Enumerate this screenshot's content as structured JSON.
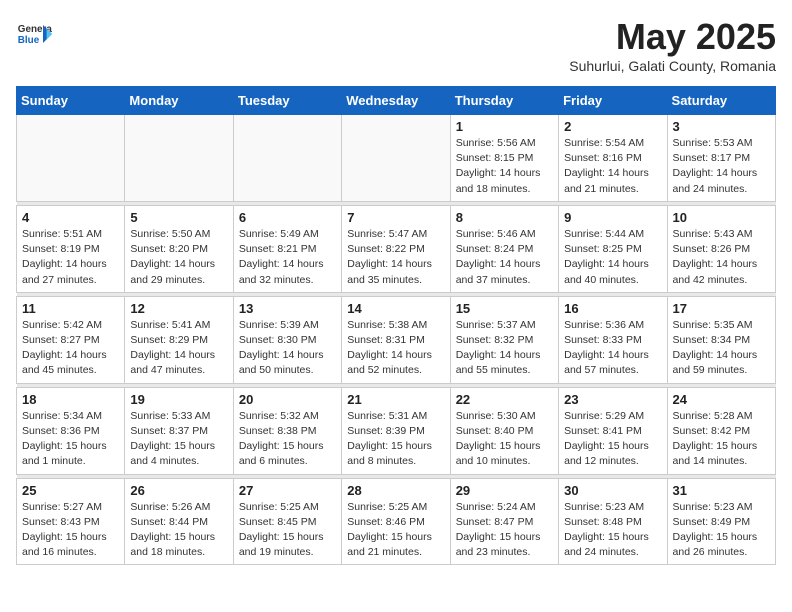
{
  "header": {
    "logo_general": "General",
    "logo_blue": "Blue",
    "month_title": "May 2025",
    "subtitle": "Suhurlui, Galati County, Romania"
  },
  "weekdays": [
    "Sunday",
    "Monday",
    "Tuesday",
    "Wednesday",
    "Thursday",
    "Friday",
    "Saturday"
  ],
  "weeks": [
    [
      {
        "day": "",
        "info": ""
      },
      {
        "day": "",
        "info": ""
      },
      {
        "day": "",
        "info": ""
      },
      {
        "day": "",
        "info": ""
      },
      {
        "day": "1",
        "info": "Sunrise: 5:56 AM\nSunset: 8:15 PM\nDaylight: 14 hours\nand 18 minutes."
      },
      {
        "day": "2",
        "info": "Sunrise: 5:54 AM\nSunset: 8:16 PM\nDaylight: 14 hours\nand 21 minutes."
      },
      {
        "day": "3",
        "info": "Sunrise: 5:53 AM\nSunset: 8:17 PM\nDaylight: 14 hours\nand 24 minutes."
      }
    ],
    [
      {
        "day": "4",
        "info": "Sunrise: 5:51 AM\nSunset: 8:19 PM\nDaylight: 14 hours\nand 27 minutes."
      },
      {
        "day": "5",
        "info": "Sunrise: 5:50 AM\nSunset: 8:20 PM\nDaylight: 14 hours\nand 29 minutes."
      },
      {
        "day": "6",
        "info": "Sunrise: 5:49 AM\nSunset: 8:21 PM\nDaylight: 14 hours\nand 32 minutes."
      },
      {
        "day": "7",
        "info": "Sunrise: 5:47 AM\nSunset: 8:22 PM\nDaylight: 14 hours\nand 35 minutes."
      },
      {
        "day": "8",
        "info": "Sunrise: 5:46 AM\nSunset: 8:24 PM\nDaylight: 14 hours\nand 37 minutes."
      },
      {
        "day": "9",
        "info": "Sunrise: 5:44 AM\nSunset: 8:25 PM\nDaylight: 14 hours\nand 40 minutes."
      },
      {
        "day": "10",
        "info": "Sunrise: 5:43 AM\nSunset: 8:26 PM\nDaylight: 14 hours\nand 42 minutes."
      }
    ],
    [
      {
        "day": "11",
        "info": "Sunrise: 5:42 AM\nSunset: 8:27 PM\nDaylight: 14 hours\nand 45 minutes."
      },
      {
        "day": "12",
        "info": "Sunrise: 5:41 AM\nSunset: 8:29 PM\nDaylight: 14 hours\nand 47 minutes."
      },
      {
        "day": "13",
        "info": "Sunrise: 5:39 AM\nSunset: 8:30 PM\nDaylight: 14 hours\nand 50 minutes."
      },
      {
        "day": "14",
        "info": "Sunrise: 5:38 AM\nSunset: 8:31 PM\nDaylight: 14 hours\nand 52 minutes."
      },
      {
        "day": "15",
        "info": "Sunrise: 5:37 AM\nSunset: 8:32 PM\nDaylight: 14 hours\nand 55 minutes."
      },
      {
        "day": "16",
        "info": "Sunrise: 5:36 AM\nSunset: 8:33 PM\nDaylight: 14 hours\nand 57 minutes."
      },
      {
        "day": "17",
        "info": "Sunrise: 5:35 AM\nSunset: 8:34 PM\nDaylight: 14 hours\nand 59 minutes."
      }
    ],
    [
      {
        "day": "18",
        "info": "Sunrise: 5:34 AM\nSunset: 8:36 PM\nDaylight: 15 hours\nand 1 minute."
      },
      {
        "day": "19",
        "info": "Sunrise: 5:33 AM\nSunset: 8:37 PM\nDaylight: 15 hours\nand 4 minutes."
      },
      {
        "day": "20",
        "info": "Sunrise: 5:32 AM\nSunset: 8:38 PM\nDaylight: 15 hours\nand 6 minutes."
      },
      {
        "day": "21",
        "info": "Sunrise: 5:31 AM\nSunset: 8:39 PM\nDaylight: 15 hours\nand 8 minutes."
      },
      {
        "day": "22",
        "info": "Sunrise: 5:30 AM\nSunset: 8:40 PM\nDaylight: 15 hours\nand 10 minutes."
      },
      {
        "day": "23",
        "info": "Sunrise: 5:29 AM\nSunset: 8:41 PM\nDaylight: 15 hours\nand 12 minutes."
      },
      {
        "day": "24",
        "info": "Sunrise: 5:28 AM\nSunset: 8:42 PM\nDaylight: 15 hours\nand 14 minutes."
      }
    ],
    [
      {
        "day": "25",
        "info": "Sunrise: 5:27 AM\nSunset: 8:43 PM\nDaylight: 15 hours\nand 16 minutes."
      },
      {
        "day": "26",
        "info": "Sunrise: 5:26 AM\nSunset: 8:44 PM\nDaylight: 15 hours\nand 18 minutes."
      },
      {
        "day": "27",
        "info": "Sunrise: 5:25 AM\nSunset: 8:45 PM\nDaylight: 15 hours\nand 19 minutes."
      },
      {
        "day": "28",
        "info": "Sunrise: 5:25 AM\nSunset: 8:46 PM\nDaylight: 15 hours\nand 21 minutes."
      },
      {
        "day": "29",
        "info": "Sunrise: 5:24 AM\nSunset: 8:47 PM\nDaylight: 15 hours\nand 23 minutes."
      },
      {
        "day": "30",
        "info": "Sunrise: 5:23 AM\nSunset: 8:48 PM\nDaylight: 15 hours\nand 24 minutes."
      },
      {
        "day": "31",
        "info": "Sunrise: 5:23 AM\nSunset: 8:49 PM\nDaylight: 15 hours\nand 26 minutes."
      }
    ]
  ]
}
